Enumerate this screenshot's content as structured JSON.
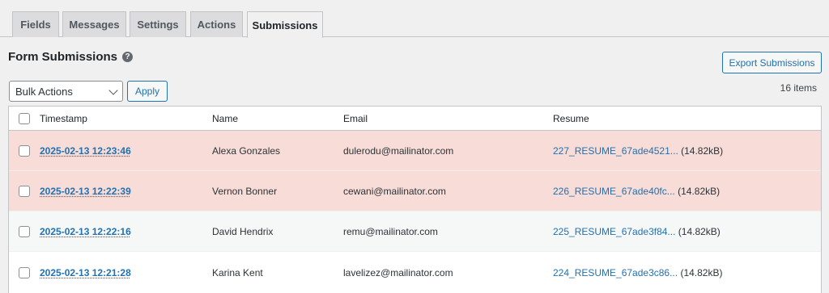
{
  "tabs": [
    {
      "label": "Fields"
    },
    {
      "label": "Messages"
    },
    {
      "label": "Settings"
    },
    {
      "label": "Actions"
    },
    {
      "label": "Submissions"
    }
  ],
  "header": {
    "title": "Form Submissions",
    "help_icon": "question-circle-icon",
    "export_label": "Export Submissions"
  },
  "toolbar": {
    "bulk_selected": "Bulk Actions",
    "apply_label": "Apply",
    "item_count": "16 items"
  },
  "table": {
    "columns": [
      "Timestamp",
      "Name",
      "Email",
      "Resume"
    ],
    "rows": [
      {
        "timestamp": "2025-02-13 12:23:46",
        "name": "Alexa Gonzales",
        "email": "dulerodu@mailinator.com",
        "file": "227_RESUME_67ade4521...",
        "size": "(14.82kB)",
        "highlight": true
      },
      {
        "timestamp": "2025-02-13 12:22:39",
        "name": "Vernon Bonner",
        "email": "cewani@mailinator.com",
        "file": "226_RESUME_67ade40fc...",
        "size": "(14.82kB)",
        "highlight": true
      },
      {
        "timestamp": "2025-02-13 12:22:16",
        "name": "David Hendrix",
        "email": "remu@mailinator.com",
        "file": "225_RESUME_67ade3f84...",
        "size": "(14.82kB)",
        "highlight": false
      },
      {
        "timestamp": "2025-02-13 12:21:28",
        "name": "Karina Kent",
        "email": "lavelizez@mailinator.com",
        "file": "224_RESUME_67ade3c86...",
        "size": "(14.82kB)",
        "highlight": false
      }
    ]
  },
  "colors": {
    "highlight_row": "#f7dcd7",
    "alt_row": "#f6f7f7",
    "link": "#2271b1"
  }
}
